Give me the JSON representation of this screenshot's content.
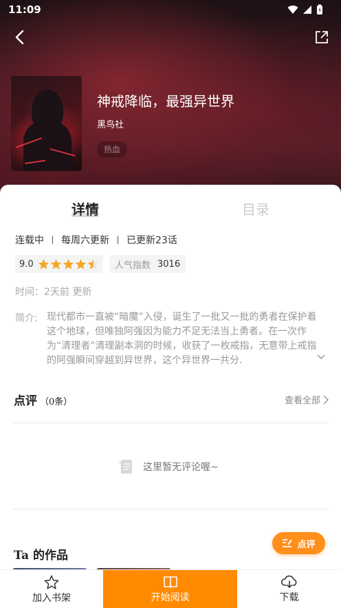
{
  "status_bar": {
    "time": "11:09"
  },
  "book": {
    "title": "神戒降临，最强异世界",
    "publisher": "黑鸟社",
    "tag": "热血"
  },
  "tabs": [
    {
      "label": "详情",
      "active": true
    },
    {
      "label": "目录",
      "active": false
    }
  ],
  "meta": {
    "status": "连载中",
    "schedule": "每周六更新",
    "updated": "已更新23话"
  },
  "rating": {
    "score": "9.0",
    "stars": 4.5
  },
  "popularity": {
    "label": "人气指数",
    "value": "3016"
  },
  "time_row": "时间：2天前 更新",
  "intro": {
    "label": "简介:",
    "text": "现代都市一直被“暗魔”入侵，诞生了一批又一批的勇者在保护着这个地球，但唯独阿强因为能力不足无法当上勇者。在一次作为“清理者”清理副本洞的时候，收获了一枚戒指，无意带上戒指的阿强瞬间穿越到异世界，这个异世界一共分."
  },
  "reviews": {
    "title": "点评",
    "count": "（0条）",
    "view_all": "查看全部",
    "empty_text": "这里暂无评论喔~"
  },
  "works": {
    "title": "Ta 的作品"
  },
  "fab": {
    "label": "点评"
  },
  "bottom_bar": {
    "shelf": "加入书架",
    "read": "开始阅读",
    "download": "下载"
  },
  "colors": {
    "accent": "#ff8a00",
    "star": "#f5a623"
  }
}
